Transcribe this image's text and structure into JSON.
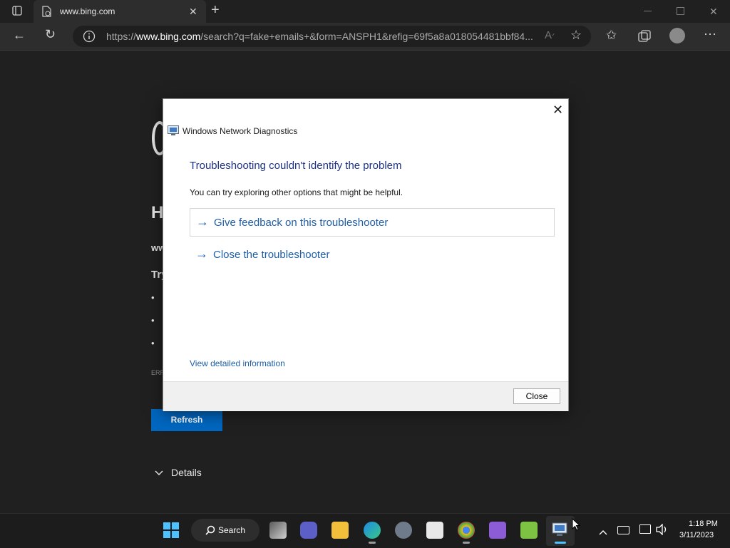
{
  "browser": {
    "tab_title": "www.bing.com",
    "url_prefix": "https://",
    "url_domain": "www.bing.com",
    "url_rest": "/search?q=fake+emails+&form=ANSPH1&refig=69f5a8a018054481bbf84..."
  },
  "page": {
    "heading_partial": "H",
    "line1_partial": "ww",
    "line2_partial": "Try",
    "bullets": [
      "•",
      "•",
      "•"
    ],
    "error_partial": "ERR",
    "refresh_label": "Refresh",
    "details_label": "Details"
  },
  "dialog": {
    "title": "Windows Network Diagnostics",
    "heading": "Troubleshooting couldn't identify the problem",
    "description": "You can try exploring other options that might be helpful.",
    "options": [
      {
        "label": "Give feedback on this troubleshooter"
      },
      {
        "label": "Close the troubleshooter"
      }
    ],
    "detail_link": "View detailed information",
    "close_label": "Close"
  },
  "taskbar": {
    "search_label": "Search",
    "time": "1:18 PM",
    "date": "3/11/2023"
  },
  "colors": {
    "accent": "#0067c0",
    "link": "#1e5ea8",
    "heading": "#1e3287"
  }
}
